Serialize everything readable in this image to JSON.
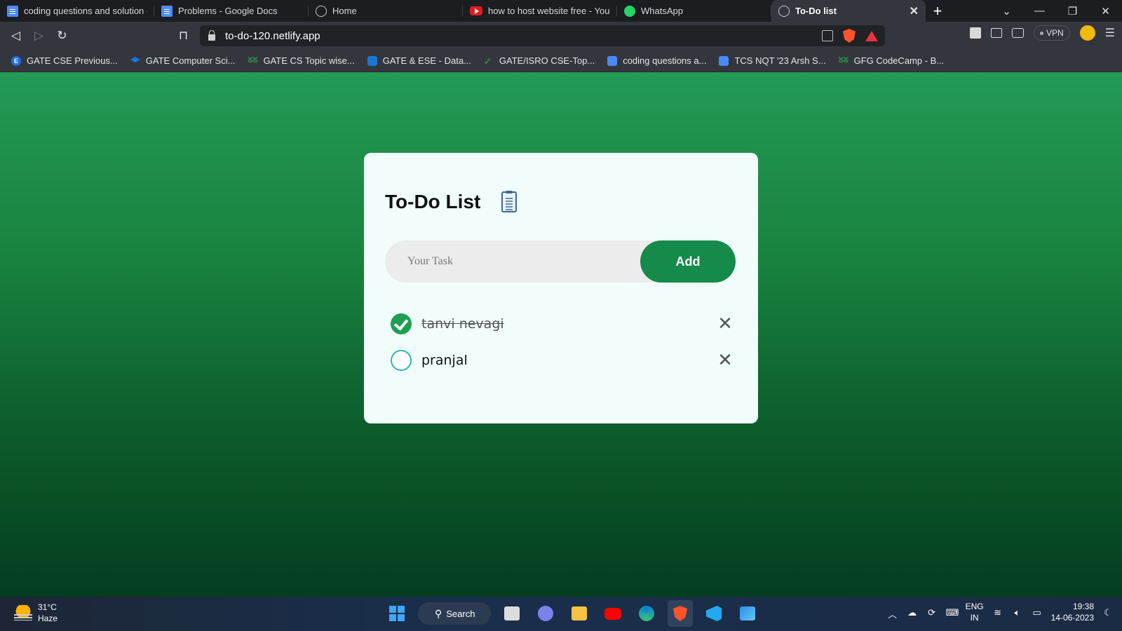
{
  "browser": {
    "tabs": [
      {
        "title": "coding questions and solution - ",
        "favicon": "docs-icon",
        "active": false
      },
      {
        "title": "Problems - Google Docs",
        "favicon": "docs-icon",
        "active": false
      },
      {
        "title": "Home",
        "favicon": "globe-icon",
        "active": false
      },
      {
        "title": "how to host website free - YouTu",
        "favicon": "youtube-icon",
        "active": false
      },
      {
        "title": "WhatsApp",
        "favicon": "whatsapp-icon",
        "active": false
      },
      {
        "title": "To-Do list",
        "favicon": "globe-icon",
        "active": true
      }
    ],
    "url": "to-do-120.netlify.app",
    "vpn_label": "VPN",
    "bookmarks": [
      "GATE CSE Previous...",
      "GATE Computer Sci...",
      "GATE CS Topic wise...",
      "GATE & ESE - Data...",
      "GATE/ISRO CSE-Top...",
      "coding questions a...",
      "TCS NQT '23 Arsh S...",
      "GFG CodeCamp - B..."
    ]
  },
  "app": {
    "title": "To-Do List",
    "input_placeholder": "Your Task",
    "input_value": "",
    "add_label": "Add",
    "tasks": [
      {
        "text": "tanvi nevagi",
        "done": true
      },
      {
        "text": "pranjal",
        "done": false
      }
    ],
    "colors": {
      "accent": "#168a4a",
      "check": "#1e9e52",
      "card_bg": "#f0fdfb"
    }
  },
  "taskbar": {
    "temperature": "31°C",
    "weather": "Haze",
    "search_label": "Search",
    "lang_top": "ENG",
    "lang_bottom": "IN",
    "time": "19:38",
    "date": "14-06-2023"
  }
}
